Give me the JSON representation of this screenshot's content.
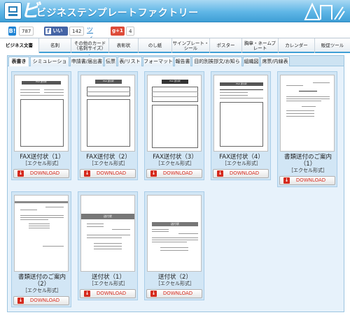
{
  "site": {
    "title": "ビジネステンプレートファクトリー",
    "logo_glyph": "ビ"
  },
  "social": {
    "hatena_label": "B!",
    "hatena_count": "787",
    "facebook_label": "いいね！",
    "facebook_count": "142",
    "tweet_label": "ツイート",
    "gplus_label": "g+1",
    "gplus_count": "4"
  },
  "mainnav": [
    {
      "label": "ビジネス文書"
    },
    {
      "label": "名刺"
    },
    {
      "label": "その他のカード（名刺サイズ）"
    },
    {
      "label": "表彰状"
    },
    {
      "label": "のし紙"
    },
    {
      "label": "サインプレート・シール"
    },
    {
      "label": "ポスター"
    },
    {
      "label": "胸章・ネームプレート"
    },
    {
      "label": "カレンダー"
    },
    {
      "label": "販促ツール"
    }
  ],
  "subnav": [
    {
      "label": "表書き"
    },
    {
      "label": "シミュレーション"
    },
    {
      "label": "申請書/届出書"
    },
    {
      "label": "伝票"
    },
    {
      "label": "表/リスト"
    },
    {
      "label": "フォーマット"
    },
    {
      "label": "報告書"
    },
    {
      "label": "目的別挨拶文/お知らせ"
    },
    {
      "label": "組織図"
    },
    {
      "label": "席票/内線表"
    }
  ],
  "cards": [
    {
      "name": "FAX送付状（1）",
      "format": "［エクセル形式］",
      "download": "DOWNLOAD"
    },
    {
      "name": "FAX送付状（2）",
      "format": "［エクセル形式］",
      "download": "DOWNLOAD"
    },
    {
      "name": "FAX送付状（3）",
      "format": "［エクセル形式］",
      "download": "DOWNLOAD"
    },
    {
      "name": "FAX送付状（4）",
      "format": "［エクセル形式］",
      "download": "DOWNLOAD"
    },
    {
      "name": "書類送付のご案内（1）",
      "format": "［エクセル形式］",
      "download": "DOWNLOAD"
    },
    {
      "name": "書類送付のご案内（2）",
      "format": "［エクセル形式］",
      "download": "DOWNLOAD"
    },
    {
      "name": "送付状（1）",
      "format": "［エクセル形式］",
      "download": "DOWNLOAD"
    },
    {
      "name": "送付状（2）",
      "format": "［エクセル形式］",
      "download": "DOWNLOAD"
    }
  ],
  "thumbs": {
    "fax1_title": "FAX 送付状",
    "fax2_title": "FAX 送付状",
    "fax3_title": "FAX 送付状",
    "fax4_title": "FAX 送付状",
    "send1_title": "送付状",
    "send2_title": "送付状"
  },
  "colors": {
    "header": "#5fb6e6",
    "accent": "#3f9fd6",
    "download": "#d52b1e",
    "card_bg": "#d2e6f5"
  }
}
